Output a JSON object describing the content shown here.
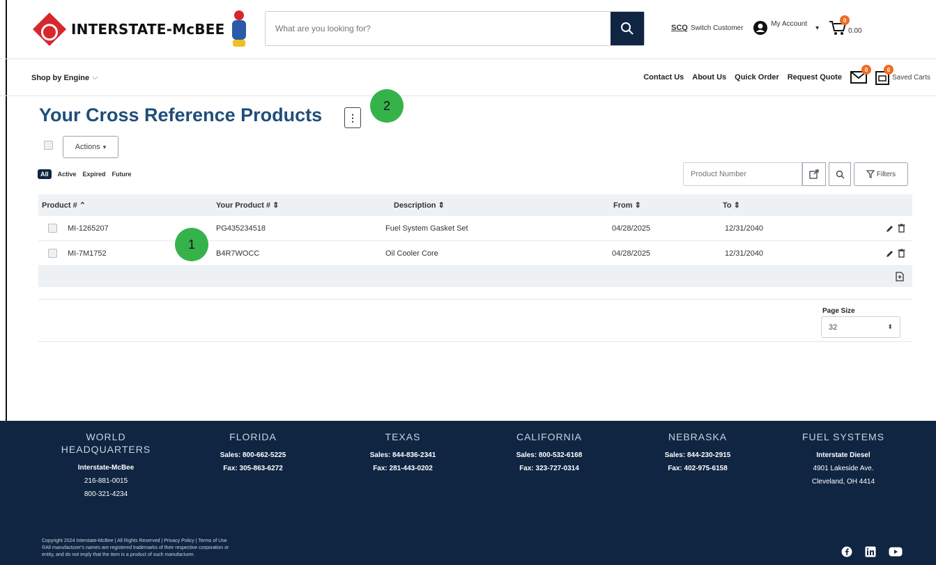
{
  "header": {
    "logo_text": "INTERSTATE-McBEE",
    "search_placeholder": "What are you looking for?",
    "switch_label": "Switch Customer",
    "switch_initials": "SCQ",
    "account_label": "My Account",
    "cart_amount": "0.00",
    "cart_count": "0"
  },
  "subnav": {
    "shop_label": "Shop by Engine",
    "links": [
      "Contact Us",
      "About Us",
      "Quick Order",
      "Request Quote"
    ],
    "messages_count": "0",
    "saved_carts_count": "0",
    "saved_carts_label": "Saved Carts"
  },
  "main": {
    "title": "Your Cross Reference Products",
    "menu_glyph": "⋮",
    "actions_label": "Actions",
    "status_tabs": [
      "All",
      "Active",
      "Expired",
      "Future"
    ],
    "product_search_placeholder": "Product Number",
    "filters_label": "Filters",
    "callouts": [
      "1",
      "2"
    ]
  },
  "table": {
    "columns": [
      "Product #",
      "Your Product #",
      "Description",
      "From",
      "To"
    ],
    "rows": [
      {
        "product": "MI-1265207",
        "your_product": "PG435234518",
        "description": "Fuel System Gasket Set",
        "from": "04/28/2025",
        "to": "12/31/2040"
      },
      {
        "product": "MI-7M1752",
        "your_product": "B4R7WOCC",
        "description": "Oil Cooler Core",
        "from": "04/28/2025",
        "to": "12/31/2040"
      }
    ]
  },
  "pagination": {
    "page_size_label": "Page Size",
    "page_size_value": "32"
  },
  "footer": {
    "columns": [
      {
        "heading": "WORLD HEADQUARTERS",
        "lines": [
          "Interstate-McBee",
          "216-881-0015",
          "800-321-4234"
        ]
      },
      {
        "heading": "FLORIDA",
        "lines": [
          "Sales: 800-662-5225",
          "Fax: 305-863-6272"
        ]
      },
      {
        "heading": "TEXAS",
        "lines": [
          "Sales: 844-836-2341",
          "Fax: 281-443-0202"
        ]
      },
      {
        "heading": "CALIFORNIA",
        "lines": [
          "Sales: 800-532-6168",
          "Fax: 323-727-0314"
        ]
      },
      {
        "heading": "NEBRASKA",
        "lines": [
          "Sales: 844-230-2915",
          "Fax: 402-975-6158"
        ]
      },
      {
        "heading": "FUEL SYSTEMS",
        "lines": [
          "Interstate Diesel",
          "4901 Lakeside Ave.",
          "Cleveland, OH 4414"
        ]
      }
    ],
    "legal": [
      "Copyright 2024 Interstate-McBee | All Rights Reserved | Privacy Policy | Terms of Use",
      "®All manufacturer's names are registered trademarks of their respective corporation or",
      "entity, and do not imply that the item is a product of such manufacturer."
    ]
  },
  "colors": {
    "navy": "#102542",
    "title_blue": "#1f4e7a",
    "callout_green": "#35b34a",
    "badge_orange": "#f26b21",
    "logo_red": "#d7272c"
  }
}
